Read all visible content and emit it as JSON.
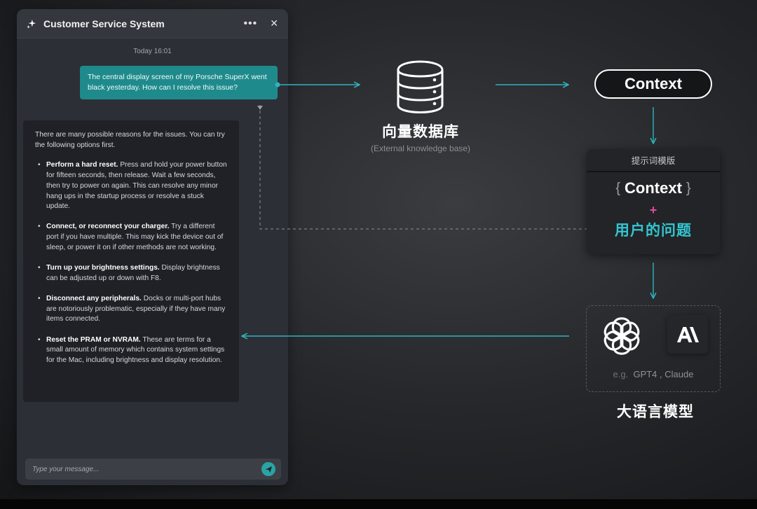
{
  "chat": {
    "title": "Customer Service System",
    "timestamp": "Today 16:01",
    "user_message": "The central display screen of my Porsche SuperX went black yesterday. How can I resolve this issue?",
    "bot_intro": "There are many possible reasons for the issues. You can try the following options first.",
    "tips": [
      {
        "title": "Perform a hard reset.",
        "text": " Press and hold your power button for fifteen seconds, then release. Wait a few seconds, then try to power on again. This can resolve any minor hang ups in the startup process or resolve a stuck update."
      },
      {
        "title": "Connect, or reconnect your charger.",
        "text": " Try a different port if you have multiple. This may kick the device out of sleep, or power it on if other methods are not working."
      },
      {
        "title": "Turn up your brightness settings.",
        "text": "  Display brightness can be adjusted up or down with F8."
      },
      {
        "title": "Disconnect any peripherals.",
        "text": " Docks or multi-port hubs are notoriously problematic, especially if they have many items connected."
      },
      {
        "title": "Reset the PRAM or NVRAM.",
        "text": " These are terms for a small amount of memory which contains system settings for the Mac, including brightness and display resolution."
      }
    ],
    "input_placeholder": "Type your message...",
    "accent_color": "#1f8a8c"
  },
  "diagram": {
    "vector_db_title": "向量数据库",
    "vector_db_subtitle": "(External knowledge base)",
    "context_label": "Context",
    "template_title": "提示词模版",
    "template_context": "Context",
    "brace_open": "{",
    "brace_close": "}",
    "plus": "+",
    "user_question": "用户的问题",
    "llm_examples_prefix": "e.g.",
    "llm_examples": "GPT4 , Claude",
    "llm_title": "大语言模型",
    "anthropic_mark": "A\\",
    "arrow_color": "#2fb3c0",
    "question_color": "#33c6d1",
    "plus_color": "#e04aa0"
  }
}
